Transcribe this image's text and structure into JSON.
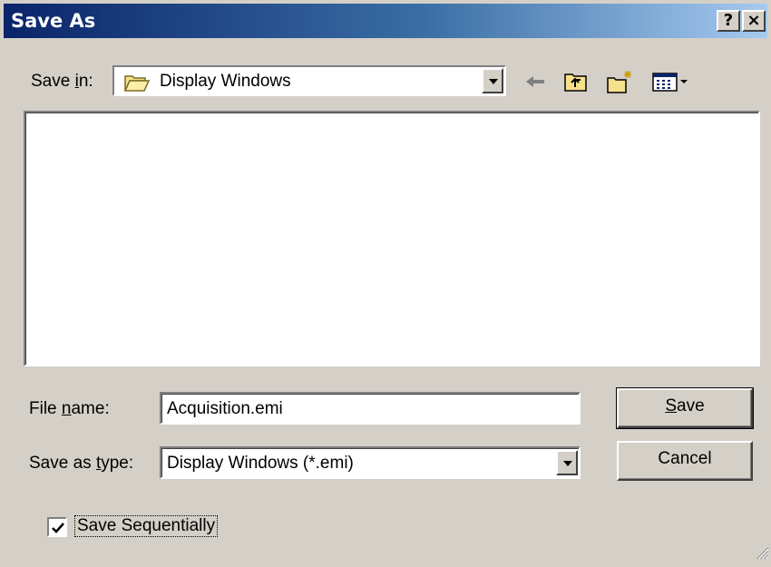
{
  "window": {
    "title": "Save As",
    "help_button": "?",
    "close_button": "×"
  },
  "save_in": {
    "label_prefix": "Save ",
    "label_accel": "i",
    "label_suffix": "n:",
    "value": "Display Windows",
    "folder_icon": "folder-icon"
  },
  "toolbar": {
    "icons": [
      "back-arrow-icon",
      "up-folder-icon",
      "new-folder-icon",
      "view-menu-icon"
    ]
  },
  "file_name": {
    "label_prefix": "File ",
    "label_accel": "n",
    "label_suffix": "ame:",
    "value": "Acquisition.emi"
  },
  "save_as_type": {
    "label_prefix": "Save as ",
    "label_accel": "t",
    "label_suffix": "ype:",
    "value": "Display Windows (*.emi)"
  },
  "buttons": {
    "save_accel": "S",
    "save_rest": "ave",
    "cancel": "Cancel"
  },
  "checkbox": {
    "label": "Save Sequentially",
    "checked": true
  },
  "colors": {
    "face": "#d4d0c8",
    "title_start": "#0a246a",
    "title_end": "#a6caf0"
  }
}
